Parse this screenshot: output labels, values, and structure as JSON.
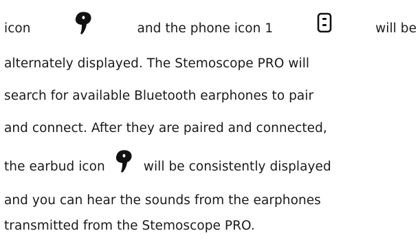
{
  "document": {
    "line1": {
      "word_icon": "icon",
      "icon1": "earbud-icon",
      "mid": "and the phone icon 1",
      "icon2": "phone-icon",
      "end": "will be"
    },
    "line2": "alternately displayed. The Stemoscope PRO will",
    "line3": "search for available Bluetooth earphones to pair",
    "line4": "and connect. After they are paired and connected,",
    "line5": {
      "start": "the earbud icon",
      "icon": "earbud-icon",
      "end": "will be consistently displayed"
    },
    "line6": "and you can hear the sounds from the earphones",
    "line7": "transmitted from the Stemoscope PRO."
  },
  "colors": {
    "text": "#1a1a1a",
    "icon": "#111111"
  }
}
